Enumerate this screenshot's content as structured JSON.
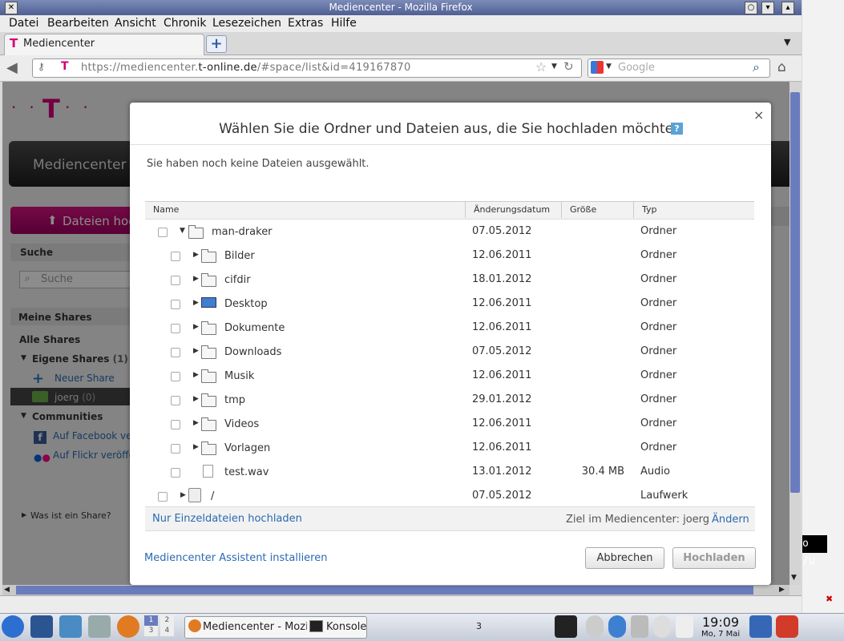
{
  "window": {
    "title": "Mediencenter - Mozilla Firefox"
  },
  "menu": [
    "Datei",
    "Bearbeiten",
    "Ansicht",
    "Chronik",
    "Lesezeichen",
    "Extras",
    "Hilfe"
  ],
  "tab": {
    "label": "Mediencenter",
    "new_tab": "+"
  },
  "urlbar": {
    "url_prefix": "https://mediencenter.",
    "url_domain": "t-online.de",
    "url_path": "/#space/list&id=419167870"
  },
  "searchbar": {
    "placeholder": "Google"
  },
  "page": {
    "header_title": "Mediencenter",
    "upload_button": "Dateien hoch",
    "search_title": "Suche",
    "search_placeholder": "Suche",
    "meine_shares": "Meine Shares",
    "alle_shares": "Alle Shares",
    "eigene_shares": "Eigene Shares",
    "eigene_count": "(1)",
    "neuer_share": "Neuer Share",
    "joerg": "joerg",
    "joerg_count": "(0)",
    "communities": "Communities",
    "facebook": "Auf Facebook verö",
    "flickr": "Auf Flickr veröffen",
    "was_ist": "Was ist ein Share?"
  },
  "modal": {
    "title": "Wählen Sie die Ordner und Dateien aus, die Sie hochladen möchten",
    "help": "?",
    "close": "×",
    "no_files": "Sie haben noch keine Dateien ausgewählt.",
    "columns": {
      "name": "Name",
      "date": "Änderungsdatum",
      "size": "Größe",
      "type": "Typ"
    },
    "rows": [
      {
        "name": "man-draker",
        "date": "07.05.2012",
        "size": "",
        "type": "Ordner"
      },
      {
        "name": "Bilder",
        "date": "12.06.2011",
        "size": "",
        "type": "Ordner"
      },
      {
        "name": "cifdir",
        "date": "18.01.2012",
        "size": "",
        "type": "Ordner"
      },
      {
        "name": "Desktop",
        "date": "12.06.2011",
        "size": "",
        "type": "Ordner"
      },
      {
        "name": "Dokumente",
        "date": "12.06.2011",
        "size": "",
        "type": "Ordner"
      },
      {
        "name": "Downloads",
        "date": "07.05.2012",
        "size": "",
        "type": "Ordner"
      },
      {
        "name": "Musik",
        "date": "12.06.2011",
        "size": "",
        "type": "Ordner"
      },
      {
        "name": "tmp",
        "date": "29.01.2012",
        "size": "",
        "type": "Ordner"
      },
      {
        "name": "Videos",
        "date": "12.06.2011",
        "size": "",
        "type": "Ordner"
      },
      {
        "name": "Vorlagen",
        "date": "12.06.2011",
        "size": "",
        "type": "Ordner"
      },
      {
        "name": "test.wav",
        "date": "13.01.2012",
        "size": "30.4 MB",
        "type": "Audio"
      },
      {
        "name": "/",
        "date": "07.05.2012",
        "size": "",
        "type": "Laufwerk"
      }
    ],
    "single_files_link": "Nur Einzeldateien hochladen",
    "target_label": "Ziel im Mediencenter: joerg",
    "change_link": "Ändern",
    "assistant_link": "Mediencenter Assistent installieren",
    "cancel_button": "Abbrechen",
    "upload_button": "Hochladen"
  },
  "terminal": {
    "text": "o /u"
  },
  "taskbar": {
    "firefox_task": "Mediencenter - Mozilla Firefox",
    "konsole_task": "Konsole",
    "workspaces": [
      "1",
      "2",
      "3",
      "4"
    ],
    "task_count": "3",
    "clock_time": "19:09",
    "clock_date": "Mo, 7 Mai"
  }
}
